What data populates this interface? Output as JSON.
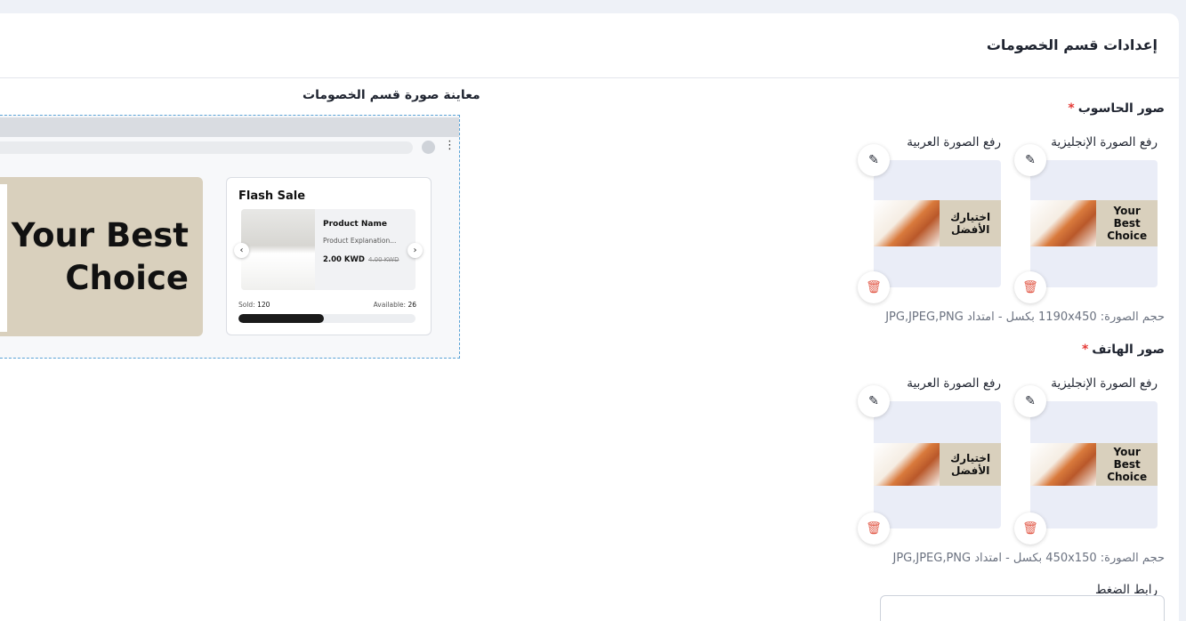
{
  "page": {
    "title": "إعدادات قسم الخصومات"
  },
  "desktop": {
    "label": "صور الحاسوب",
    "required_mark": "*",
    "english_upload": "رفع الصورة الإنجليزية",
    "arabic_upload": "رفع الصورة العربية",
    "english_banner_text": "Your Best Choice",
    "arabic_banner_text": "اختيارك الأفضل",
    "hint": "حجم الصورة: 1190x450 بكسل - امتداد JPG,JPEG,PNG"
  },
  "mobile": {
    "label": "صور الهاتف",
    "required_mark": "*",
    "english_upload": "رفع الصورة الإنجليزية",
    "arabic_upload": "رفع الصورة العربية",
    "english_banner_text": "Your Best Choice",
    "arabic_banner_text": "اختيارك الأفضل",
    "hint": "حجم الصورة: 450x150 بكسل - امتداد JPG,JPEG,PNG"
  },
  "link": {
    "label": "رابط الضغط",
    "value": ""
  },
  "icons": {
    "edit": "pencil-icon",
    "delete": "trash-icon",
    "menu": "kebab-menu-icon"
  },
  "colors": {
    "required": "#e53935",
    "delete": "#e25b4a",
    "preview_border": "#5aa3d6",
    "hero_bg": "#d9d0bd"
  },
  "preview": {
    "title": "معاينة صورة قسم الخصومات",
    "hero_text": "Your Best Choice",
    "card": {
      "title": "Flash Sale",
      "product_name": "Product Name",
      "product_desc": "Product Explanation...",
      "price": "2.00 KWD",
      "old_price": "4.00 KWD",
      "sold_label": "Sold:",
      "sold_value": "120",
      "available_label": "Available:",
      "available_value": "26",
      "progress_percent": 48
    }
  }
}
